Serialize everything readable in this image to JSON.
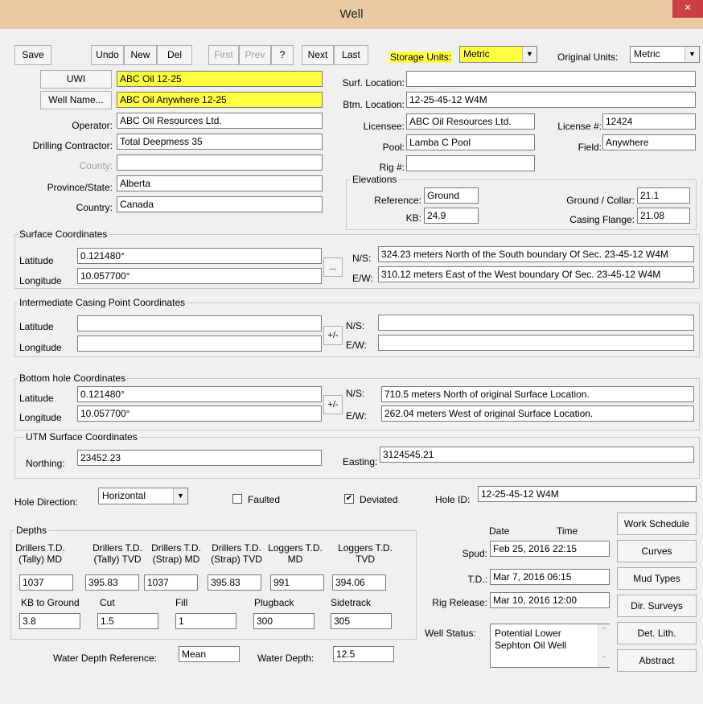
{
  "window": {
    "title": "Well",
    "close": "×"
  },
  "toolbar": {
    "save": "Save",
    "undo": "Undo",
    "new": "New",
    "del": "Del",
    "first": "First",
    "prev": "Prev",
    "help": "?",
    "next": "Next",
    "last": "Last",
    "storage_units_label": "Storage Units:",
    "storage_units_value": "Metric",
    "original_units_label": "Original Units:",
    "original_units_value": "Metric"
  },
  "well": {
    "uwi_button": "UWI",
    "uwi_value": "ABC Oil 12-25",
    "name_button": "Well Name...",
    "name_value": "ABC Oil Anywhere 12-25",
    "operator_label": "Operator:",
    "operator_value": "ABC Oil Resources Ltd.",
    "contractor_label": "Drilling Contractor:",
    "contractor_value": "Total Deepmess 35",
    "county_label": "County:",
    "county_value": "",
    "province_label": "Province/State:",
    "province_value": "Alberta",
    "country_label": "Country:",
    "country_value": "Canada",
    "surf_location_label": "Surf. Location:",
    "surf_location_value": "",
    "btm_location_label": "Btm. Location:",
    "btm_location_value": "12-25-45-12 W4M",
    "licensee_label": "Licensee:",
    "licensee_value": "ABC Oil Resources Ltd.",
    "license_label": "License #:",
    "license_value": "12424",
    "pool_label": "Pool:",
    "pool_value": "Lamba C Pool",
    "field_label": "Field:",
    "field_value": "Anywhere",
    "rig_label": "Rig #:",
    "rig_value": ""
  },
  "elevations": {
    "title": "Elevations",
    "reference_label": "Reference:",
    "reference_value": "Ground",
    "kb_label": "KB:",
    "kb_value": "24.9",
    "ground_label": "Ground / Collar:",
    "ground_value": "21.1",
    "casing_label": "Casing Flange:",
    "casing_value": "21.08"
  },
  "surface": {
    "title": "Surface Coordinates",
    "lat_label": "Latitude",
    "lat_value": "0.121480°",
    "lon_label": "Longitude",
    "lon_value": "10.057700°",
    "btn": "...",
    "ns_label": "N/S:",
    "ns_value": "324.23 meters North of the South boundary Of Sec. 23-45-12 W4M",
    "ew_label": "E/W:",
    "ew_value": "310.12 meters East of the West boundary Of Sec. 23-45-12 W4M"
  },
  "intermediate": {
    "title": "Intermediate Casing Point Coordinates",
    "lat_label": "Latitude",
    "lat_value": "",
    "lon_label": "Longitude",
    "lon_value": "",
    "btn": "+/-",
    "ns_label": "N/S:",
    "ns_value": "",
    "ew_label": "E/W:",
    "ew_value": ""
  },
  "bottom": {
    "title": "Bottom hole Coordinates",
    "lat_label": "Latitude",
    "lat_value": "0.121480°",
    "lon_label": "Longitude",
    "lon_value": "10.057700°",
    "btn": "+/-",
    "ns_label": "N/S:",
    "ns_value": "710.5 meters North of original Surface Location.",
    "ew_label": "E/W:",
    "ew_value": "262.04 meters West of original Surface Location."
  },
  "utm": {
    "title": "UTM Surface Coordinates",
    "northing_label": "Northing:",
    "northing_value": "23452.23",
    "easting_label": "Easting:",
    "easting_value": "3124545.21"
  },
  "hole": {
    "direction_label": "Hole Direction:",
    "direction_value": "Horizontal",
    "faulted_label": "Faulted",
    "deviated_label": "Deviated",
    "id_label": "Hole ID:",
    "id_value": "12-25-45-12 W4M"
  },
  "depths": {
    "title": "Depths",
    "h1a": "Drillers T.D.",
    "h1b": "(Tally) MD",
    "h2a": "Drillers T.D.",
    "h2b": "(Tally) TVD",
    "h3a": "Drillers T.D.",
    "h3b": "(Strap) MD",
    "h4a": "Drillers T.D.",
    "h4b": "(Strap) TVD",
    "h5a": "Loggers T.D.",
    "h5b": "MD",
    "h6a": "Loggers T.D.",
    "h6b": "TVD",
    "v1": "1037",
    "v2": "395.83",
    "v3": "1037",
    "v4": "395.83",
    "v5": "991",
    "v6": "394.06",
    "kb_ground_label": "KB to Ground",
    "cut_label": "Cut",
    "fill_label": "Fill",
    "plugback_label": "Plugback",
    "sidetrack_label": "Sidetrack",
    "kb_ground_value": "3.8",
    "cut_value": "1.5",
    "fill_value": "1",
    "plugback_value": "300",
    "sidetrack_value": "305",
    "water_ref_label": "Water Depth Reference:",
    "water_ref_value": "Mean",
    "water_depth_label": "Water Depth:",
    "water_depth_value": "12.5"
  },
  "dates": {
    "date_header": "Date",
    "time_header": "Time",
    "spud_label": "Spud:",
    "spud_value": "Feb 25, 2016 22:15",
    "td_label": "T.D.:",
    "td_value": "Mar 7, 2016 06:15",
    "rig_release_label": "Rig Release:",
    "rig_release_value": "Mar 10, 2016 12:00",
    "status_label": "Well Status:",
    "status_value": "Potential Lower Sephton Oil Well"
  },
  "side_buttons": {
    "work_schedule": "Work Schedule",
    "curves": "Curves",
    "mud_types": "Mud Types",
    "dir_surveys": "Dir. Surveys",
    "det_lith": "Det. Lith.",
    "abstract": "Abstract"
  }
}
